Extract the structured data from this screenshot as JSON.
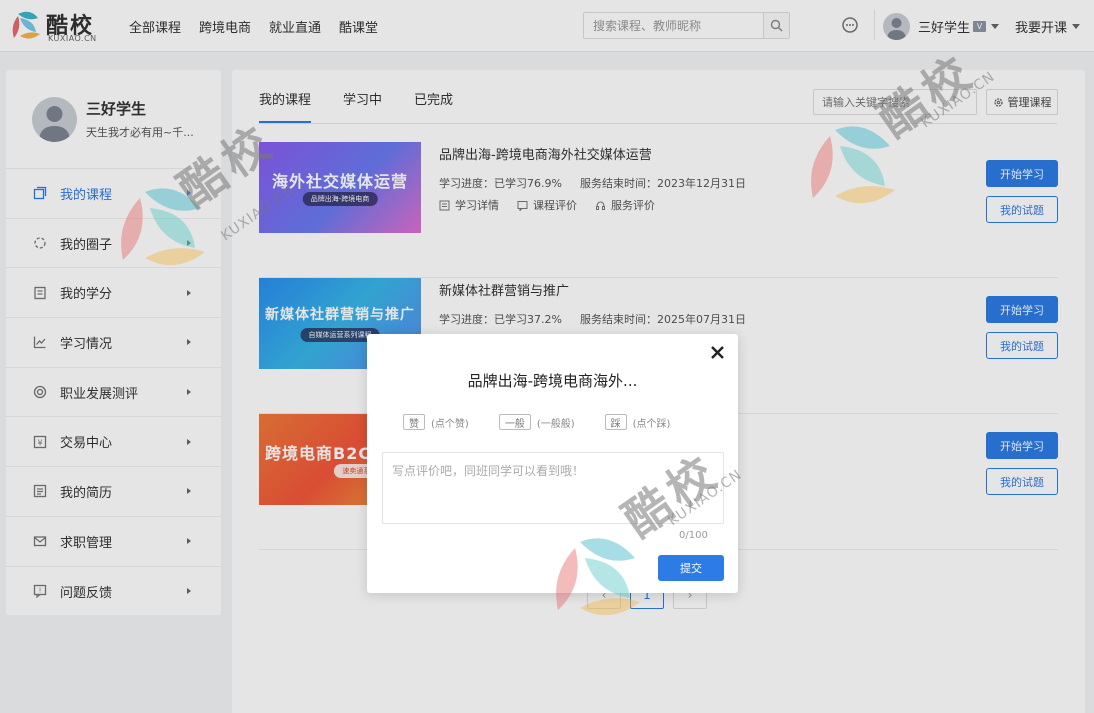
{
  "header": {
    "logo_text": "酷校",
    "logo_sub": "KUXIAO.CN",
    "nav": [
      "全部课程",
      "跨境电商",
      "就业直通",
      "酷课堂"
    ],
    "search_placeholder": "搜索课程、教师昵称",
    "user_name": "三好学生",
    "vip_badge": "V",
    "teach_label": "我要开课"
  },
  "sidebar": {
    "profile_name": "三好学生",
    "profile_motto": "天生我才必有用~千...",
    "items": [
      {
        "label": "我的课程",
        "icon": "courses-icon",
        "active": true
      },
      {
        "label": "我的圈子",
        "icon": "circle-icon",
        "active": false
      },
      {
        "label": "我的学分",
        "icon": "credits-icon",
        "active": false
      },
      {
        "label": "学习情况",
        "icon": "chart-icon",
        "active": false
      },
      {
        "label": "职业发展测评",
        "icon": "target-icon",
        "active": false
      },
      {
        "label": "交易中心",
        "icon": "trade-icon",
        "active": false
      },
      {
        "label": "我的简历",
        "icon": "resume-icon",
        "active": false
      },
      {
        "label": "求职管理",
        "icon": "mail-icon",
        "active": false
      },
      {
        "label": "问题反馈",
        "icon": "feedback-icon",
        "active": false
      }
    ]
  },
  "main": {
    "tabs": [
      "我的课程",
      "学习中",
      "已完成"
    ],
    "keyword_placeholder": "请输入关键字搜索",
    "manage_label": "管理课程",
    "courses": [
      {
        "title": "品牌出海-跨境电商海外社交媒体运营",
        "progress": "学习进度：已学习76.9%",
        "end_time": "服务结束时间：2023年12月31日",
        "links": [
          "学习详情",
          "课程评价",
          "服务评价"
        ],
        "thumb_title": "海外社交媒体运营",
        "thumb_sub": "品牌出海-跨境电商",
        "start_label": "开始学习",
        "exam_label": "我的试题"
      },
      {
        "title": "新媒体社群营销与推广",
        "progress": "学习进度：已学习37.2%",
        "end_time": "服务结束时间：2025年07月31日",
        "thumb_title": "新媒体社群营销与推广",
        "thumb_sub": "自媒体运营系列课程",
        "start_label": "开始学习",
        "exam_label": "我的试题"
      },
      {
        "thumb_title": "跨境电商B2C数",
        "thumb_sub": "速卖通系列课程2.0",
        "start_label": "开始学习",
        "exam_label": "我的试题"
      }
    ],
    "pager": [
      "‹",
      "1",
      "›"
    ]
  },
  "modal": {
    "title": "品牌出海-跨境电商海外...",
    "ratings": [
      {
        "chip": "赞",
        "hint": "(点个赞)"
      },
      {
        "chip": "一般",
        "hint": "(一般般)"
      },
      {
        "chip": "踩",
        "hint": "(点个踩)"
      }
    ],
    "comment_placeholder": "写点评价吧，同班同学可以看到哦！",
    "count": "0/100",
    "submit_label": "提交"
  },
  "watermark": {
    "text": "酷校",
    "sub": "KUXIAO.CN"
  },
  "colors": {
    "accent": "#2d7be5"
  }
}
